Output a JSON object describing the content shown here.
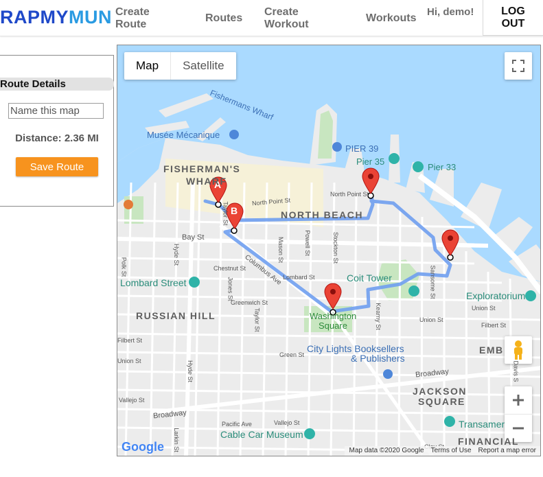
{
  "brand": {
    "part1": "RAPMY",
    "part2": "MUN"
  },
  "nav": {
    "create_route": "Create Route",
    "routes": "Routes",
    "create_workout": "Create Workout",
    "workouts": "Workouts",
    "greeting": "Hi, demo!",
    "logout": "LOG OUT"
  },
  "panel": {
    "title": "Route Details",
    "name_placeholder": "Name this map",
    "distance": "Distance: 2.36 MI",
    "save_label": "Save Route"
  },
  "map": {
    "type_map": "Map",
    "type_satellite": "Satellite",
    "markers": [
      "A",
      "B"
    ],
    "labels": {
      "fishermans_wharf_water": "Fishermans Wharf",
      "musee": "Musée Mécanique",
      "pier39": "PIER 39",
      "pier35": "Pier 35",
      "pier33": "Pier 33",
      "fishermans_wharf": "FISHERMAN'S",
      "wharf": "WHARF",
      "north_beach": "NORTH BEACH",
      "russian_hill": "RUSSIAN HILL",
      "lombard_street": "Lombard Street",
      "coit_tower": "Coit Tower",
      "exploratorium": "Exploratorium",
      "washington_square_1": "Washington",
      "washington_square_2": "Square",
      "city_lights_1": "City Lights Booksellers",
      "city_lights_2": "& Publishers",
      "jackson_square_1": "JACKSON",
      "jackson_square_2": "SQUARE",
      "financial": "FINANCIAL",
      "embarcadero_partial": "EMB",
      "transamerica": "Transamer",
      "cable_car_museum": "Cable Car Museum",
      "bay_st": "Bay St",
      "north_point_st": "North Point St",
      "north_point_st_2": "North Point St",
      "columbus_ave": "Columbus Ave",
      "lombard_st": "Lombard St",
      "chestnut_st": "Chestnut St",
      "greenwich_st": "Greenwich St",
      "union_st": "Union St",
      "union_st_2": "Union St",
      "filbert_st": "Filbert St",
      "filbert_st_2": "Filbert St",
      "green_st": "Green St",
      "vallejo_st": "Vallejo St",
      "vallejo_st_2": "Vallejo St",
      "broadway": "Broadway",
      "broadway_2": "Broadway",
      "pacific_ave": "Pacific Ave",
      "clay_st": "Clay St",
      "hyde_st": "Hyde St",
      "hyde_st_2": "Hyde St",
      "larkin_st": "Larkin St",
      "polk_st": "Polk St",
      "jones_st": "Jones St",
      "taylor_st": "Taylor St",
      "taylor_st_2": "Taylor St",
      "mason_st": "Mason St",
      "powell_st": "Powell St",
      "stockton_st": "Stockton St",
      "kearny_st": "Kearny St",
      "sansome_st": "Sansome St",
      "davis_st": "Davis S",
      "union_st_3": "Union St"
    },
    "attribution": {
      "data": "Map data ©2020 Google",
      "terms": "Terms of Use",
      "report": "Report a map error"
    },
    "google": "Google",
    "colors": {
      "water": "#aadaff",
      "land": "#ececec",
      "road": "#ffffff",
      "route": "#6f9ef0",
      "marker": "#ea4335",
      "park": "#c8e6c0"
    }
  }
}
